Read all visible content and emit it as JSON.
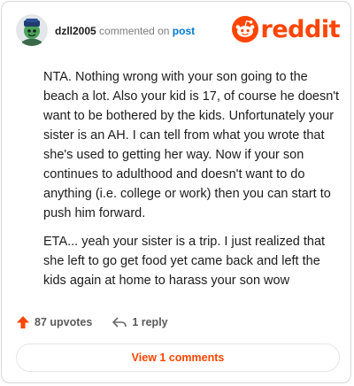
{
  "comment": {
    "username": "dzll2005",
    "action": "commented on",
    "target": "post",
    "paragraphs": [
      "NTA. Nothing wrong with your son going to the beach a lot. Also your kid is 17, of course he doesn't want to be bothered by the kids. Unfortunately your sister is an AH. I can tell from what you wrote that she's used to getting her way. Now if your son continues to adulthood and doesn't want to do anything (i.e. college or work) then you can start to push him forward.",
      "ETA... yeah your sister is a trip. I just realized that she left to go get food yet came back and left the kids again at home to harass your son wow"
    ]
  },
  "brand": {
    "name": "reddit",
    "color": "#ff4500"
  },
  "actions": {
    "upvotes": "87 upvotes",
    "replies": "1 reply"
  },
  "footer": {
    "view_comments_label": "View 1 comments"
  }
}
